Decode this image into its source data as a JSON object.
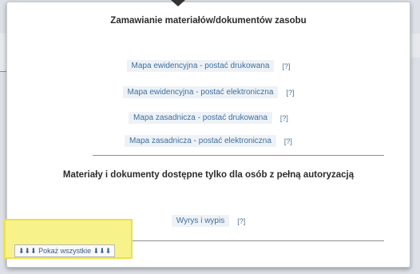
{
  "popup": {
    "title": "Zamawianie materiałów/dokumentów zasobu",
    "links": [
      {
        "label": "Mapa ewidencyjna - postać drukowana",
        "help": "[?]"
      },
      {
        "label": "Mapa ewidencyjna - postać elektroniczna",
        "help": "[?]"
      },
      {
        "label": "Mapa zasadnicza - postać drukowana",
        "help": "[?]"
      },
      {
        "label": "Mapa zasadnicza - postać elektroniczna",
        "help": "[?]"
      }
    ],
    "restricted_heading": "Materiały i dokumenty dostępne tylko dla osób z pełną autoryzacją",
    "restricted_links": [
      {
        "label": "Wyrys i wypis",
        "help": "[?]"
      }
    ]
  },
  "footer": {
    "show_all_label": "⬇⬇⬇ Pokaż wszystkie ⬇⬇⬇"
  },
  "colors": {
    "link_text": "#3f6fa0",
    "link_background": "#eef2f6",
    "highlight": "#f7f28a"
  }
}
